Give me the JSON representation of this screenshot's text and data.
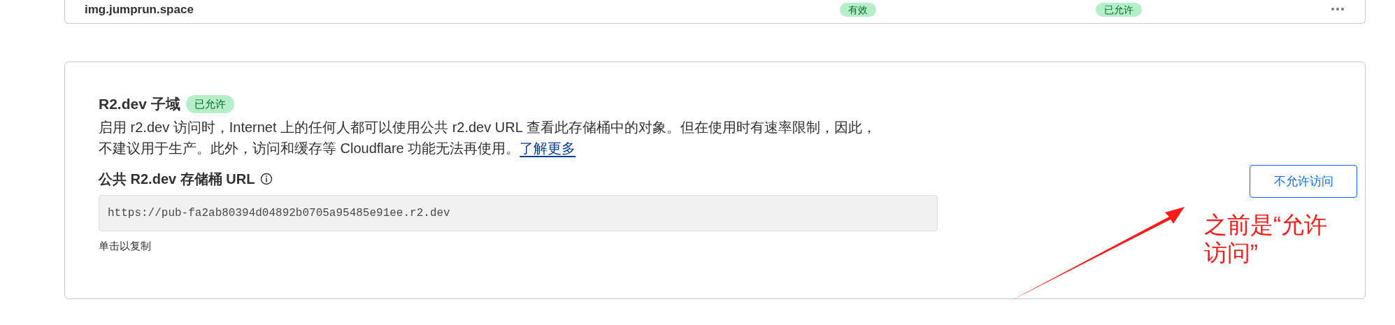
{
  "domain_row": {
    "domain": "img.jumprun.space",
    "status": "有效",
    "access": "已允许"
  },
  "r2_dev": {
    "title": "R2.dev 子域",
    "badge": "已允许",
    "description_lines": [
      "启用 r2.dev 访问时，Internet 上的任何人都可以使用公共 r2.dev URL 查看此存储桶中的对象。但在使用时有速率限制，因此，",
      "不建议用于生产。此外，访问和缓存等 Cloudflare 功能无法再使用。"
    ],
    "learn_more": "了解更多",
    "url_label": "公共 R2.dev 存储桶 URL",
    "url": "https://pub-fa2ab80394d04892b0705a95485e91ee.r2.dev",
    "copy_hint": "单击以复制",
    "button": "不允许访问"
  },
  "annotation": {
    "text_lines": [
      "之前是“允许",
      "访问”"
    ]
  }
}
